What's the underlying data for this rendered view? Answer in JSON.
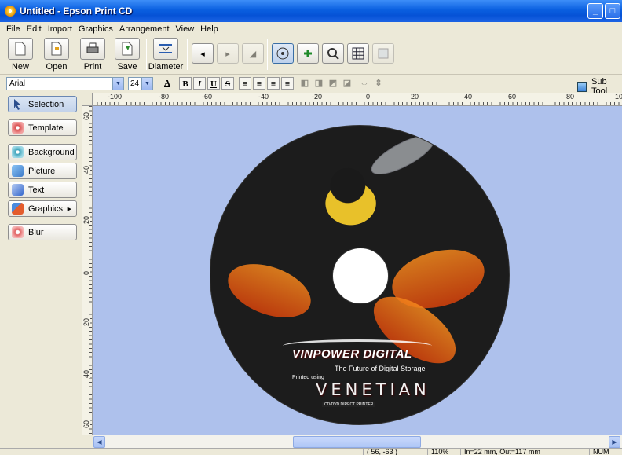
{
  "window": {
    "title": "Untitled - Epson Print CD",
    "controls": {
      "minimize": "_",
      "maximize": "□",
      "close": "×"
    }
  },
  "menu": [
    "File",
    "Edit",
    "Import",
    "Graphics",
    "Arrangement",
    "View",
    "Help"
  ],
  "toolbar": {
    "new_label": "New",
    "open_label": "Open",
    "print_label": "Print",
    "save_label": "Save",
    "diameter_label": "Diameter",
    "icons": [
      "undo-icon",
      "redo-icon",
      "eraser-icon",
      "select-object-icon",
      "zoom-in-icon",
      "zoom-out-icon",
      "grid-icon",
      "preview-icon"
    ]
  },
  "format": {
    "font": "Arial",
    "size": "24",
    "bold": "B",
    "italic": "I",
    "underline": "U",
    "strike": "S",
    "font_color": "A",
    "subtool_label": "Sub Tool"
  },
  "left_tools": [
    {
      "label": "Selection",
      "icon": "arrow-pointer-icon",
      "color": "#2c4f8e",
      "selected": true
    },
    {
      "label": "Template",
      "icon": "template-icon",
      "color": "#d64a4a"
    },
    {
      "label": "Background",
      "icon": "background-icon",
      "color": "#3aa0b8"
    },
    {
      "label": "Picture",
      "icon": "picture-icon",
      "color": "#3d7ac9"
    },
    {
      "label": "Text",
      "icon": "text-icon",
      "color": "#3366cc"
    },
    {
      "label": "Graphics",
      "icon": "graphics-icon",
      "color": "#e35c2d",
      "has_submenu": true
    },
    {
      "label": "Blur",
      "icon": "blur-icon",
      "color": "#e06060"
    }
  ],
  "ruler": {
    "h_labels": [
      "-100",
      "-80",
      "-60",
      "-40",
      "-20",
      "0",
      "20",
      "40",
      "60",
      "80",
      "10"
    ],
    "v_labels": [
      "60",
      "40",
      "20",
      "0",
      "20",
      "40",
      "60"
    ]
  },
  "disc": {
    "brand": "VINPOWER DIGITAL",
    "tagline": "The Future of Digital Storage",
    "printed_using": "Printed using",
    "product": "VENETIAN",
    "product_sub": "CD/DVD DIRECT PRINTER"
  },
  "status": {
    "coords": "( 56, -63 )",
    "zoom": "110%",
    "inout": "In=22 mm, Out=117 mm",
    "num": "NUM"
  },
  "colors": {
    "title_bar": "#0552d6",
    "canvas_bg": "#aec1ec",
    "window_bg": "#ece9d8"
  }
}
